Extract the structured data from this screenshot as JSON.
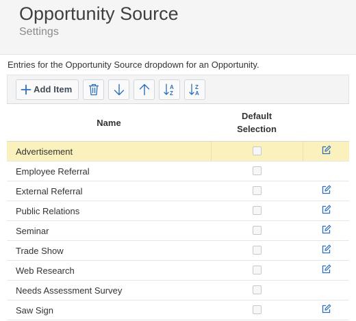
{
  "header": {
    "title": "Opportunity Source",
    "subtitle": "Settings"
  },
  "description": "Entries for the Opportunity Source dropdown for an Opportunity.",
  "toolbar": {
    "add_label": "Add Item",
    "buttons": [
      "plus-icon",
      "trash-icon",
      "arrow-down-icon",
      "arrow-up-icon",
      "sort-ascending-icon",
      "sort-descending-icon"
    ]
  },
  "table": {
    "headers": {
      "name": "Name",
      "default_line1": "Default",
      "default_line2": "Selection"
    },
    "rows": [
      {
        "name": "Advertisement",
        "default": false,
        "editable": true,
        "selected": true
      },
      {
        "name": "Employee Referral",
        "default": false,
        "editable": false,
        "selected": false
      },
      {
        "name": "External Referral",
        "default": false,
        "editable": true,
        "selected": false
      },
      {
        "name": "Public Relations",
        "default": false,
        "editable": true,
        "selected": false
      },
      {
        "name": "Seminar",
        "default": false,
        "editable": true,
        "selected": false
      },
      {
        "name": "Trade Show",
        "default": false,
        "editable": true,
        "selected": false
      },
      {
        "name": "Web Research",
        "default": false,
        "editable": true,
        "selected": false
      },
      {
        "name": "Needs Assessment Survey",
        "default": false,
        "editable": false,
        "selected": false
      },
      {
        "name": "Saw Sign",
        "default": false,
        "editable": true,
        "selected": false
      }
    ]
  },
  "colors": {
    "accent": "#2a6ebb",
    "selected_row": "#fbf1bd",
    "header_bg": "#f5f5f5",
    "toolbar_bg": "#f4f4f4"
  }
}
